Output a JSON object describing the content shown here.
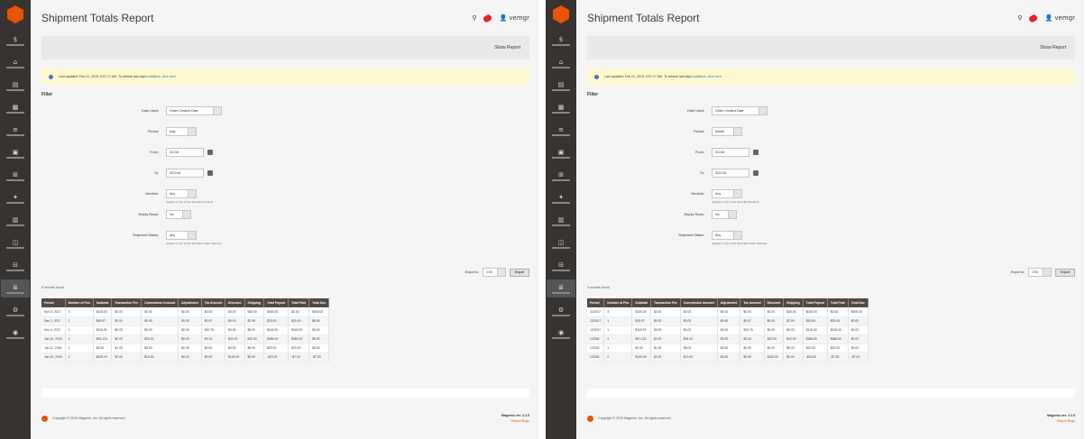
{
  "colors": {
    "sidebar": "#373330",
    "brand": "#eb5202",
    "notice": "#fdf8ce",
    "grid_header": "#514943",
    "link": "#1979c3"
  },
  "panels": [
    {
      "title": "Shipment Totals Report",
      "user": "vemgr",
      "show_report": "Show Report",
      "notice_text": "Last updated: Feb 21, 2019, 9:57:17 AM. To refresh last day's",
      "notice_link": "statistics, click here.",
      "filter_title": "Filter",
      "fields": {
        "date_used_label": "Date Used:",
        "date_used_value": "Order Created Date",
        "period_label": "Period:",
        "period_value": "Day",
        "from_label": "From:",
        "from_value": "3/1/18",
        "to_label": "To:",
        "to_value": "3/21/18",
        "vendor_label": "Vendors:",
        "vendor_value": "Any",
        "vendor_hint": "Applies to Any of the Specified Vendors",
        "empty_label": "Empty Rows:",
        "empty_value": "No",
        "status_label": "Shipment Status:",
        "status_value": "Any",
        "status_hint": "Applies to Any of the Specified Order Statuses"
      },
      "export_label": "Export to:",
      "export_format": "CSV",
      "export_button": "Export",
      "records": "0 records found",
      "columns": [
        "Period",
        "Number of Pos",
        "Subtotal",
        "Transaction Fee",
        "Commission Amount",
        "Adjustment",
        "Tax Amount",
        "Discount",
        "Shipping",
        "Total Payout",
        "Total Paid",
        "Total Due"
      ],
      "rows": [
        [
          "Nov 5, 2017",
          "3",
          "$100.00",
          "$0.00",
          "$0.00",
          "$0.00",
          "$0.00",
          "$0.00",
          "$30.00",
          "$000.00",
          "$0.00",
          "$000.00"
        ],
        [
          "Dec 2, 2017",
          "1",
          "$15.97",
          "$0.00",
          "$0.00",
          "$0.00",
          "$0.97",
          "$0.00",
          "$2.99",
          "$20.00",
          "$20.00",
          "$0.00"
        ],
        [
          "Dec 4, 2017",
          "1",
          "$115.91",
          "$0.00",
          "$0.00",
          "$0.00",
          "$10.76",
          "$0.00",
          "$0.00",
          "$115.00",
          "$115.00",
          "$0.00"
        ],
        [
          "Jan 10, 2018",
          "3",
          "$91.124",
          "$2.00",
          "$34.02",
          "$0.00",
          "$3.24",
          "$22.00",
          "$10.00",
          "$384.00",
          "$384.00",
          "$0.00"
        ],
        [
          "Jan 11, 2018",
          "1",
          "$0.00",
          "$1.00",
          "$5.00",
          "$0.00",
          "$0.00",
          "$0.00",
          "$5.00",
          "$20.00",
          "$20.00",
          "$0.00"
        ],
        [
          "Jan 15, 2018",
          "2",
          "$100.00",
          "$2.00",
          "$13.00",
          "$0.00",
          "$0.00",
          "$100.00",
          "$0.00",
          "-$15.00",
          "-$7.00",
          "-$7.00"
        ]
      ],
      "copyright": "Copyright © 2019 Magento, Inc. All rights reserved.",
      "version": "Magento ver. 2.2.5",
      "report_bugs": "Report Bugs"
    },
    {
      "title": "Shipment Totals Report",
      "user": "vemgr",
      "show_report": "Show Report",
      "notice_text": "Last updated: Feb 21, 2019, 9:57:17 AM. To refresh last day's",
      "notice_link": "statistics, click here.",
      "filter_title": "Filter",
      "fields": {
        "date_used_label": "Date Used:",
        "date_used_value": "Order Created Date",
        "period_label": "Period:",
        "period_value": "Month",
        "from_label": "From:",
        "from_value": "3/1/18",
        "to_label": "To:",
        "to_value": "3/21/18",
        "vendor_label": "Vendors:",
        "vendor_value": "Any",
        "vendor_hint": "Applies to Any of the Specified Vendors",
        "empty_label": "Empty Rows:",
        "empty_value": "No",
        "status_label": "Shipment Status:",
        "status_value": "Any",
        "status_hint": "Applies to Any of the Specified Order Statuses"
      },
      "export_label": "Export to:",
      "export_format": "CSV",
      "export_button": "Export",
      "records": "0 records found",
      "columns": [
        "Period",
        "Number of Pos",
        "Subtotal",
        "Transaction Fee",
        "Commission Amount",
        "Adjustment",
        "Tax Amount",
        "Discount",
        "Shipping",
        "Total Payout",
        "Total Paid",
        "Total Due"
      ],
      "rows": [
        [
          "11/2017",
          "3",
          "$100.00",
          "$0.00",
          "$0.00",
          "$0.00",
          "$0.00",
          "$0.00",
          "$30.00",
          "$000.00",
          "$0.00",
          "$000.00"
        ],
        [
          "12/2017",
          "1",
          "$15.97",
          "$0.00",
          "$0.00",
          "$0.00",
          "$0.97",
          "$0.00",
          "$2.99",
          "$20.00",
          "$20.00",
          "$0.00"
        ],
        [
          "12/2017",
          "1",
          "$115.91",
          "$0.00",
          "$0.00",
          "$0.00",
          "$10.76",
          "$0.00",
          "$0.00",
          "$115.00",
          "$115.00",
          "$0.00"
        ],
        [
          "1/2018",
          "3",
          "$91.124",
          "$2.00",
          "$34.02",
          "$0.00",
          "$3.24",
          "$22.00",
          "$10.00",
          "$384.00",
          "$384.00",
          "$0.00"
        ],
        [
          "1/2018",
          "1",
          "$0.00",
          "$1.00",
          "$5.00",
          "$0.00",
          "$0.00",
          "$0.00",
          "$5.00",
          "$20.00",
          "$20.00",
          "$0.00"
        ],
        [
          "1/2018",
          "2",
          "$100.00",
          "$2.00",
          "$13.00",
          "$0.00",
          "$0.00",
          "$100.00",
          "$0.00",
          "-$15.00",
          "-$7.00",
          "-$7.00"
        ]
      ],
      "copyright": "Copyright © 2019 Magento, Inc. All rights reserved.",
      "version": "Magento ver. 2.2.5",
      "report_bugs": "Report Bugs"
    }
  ]
}
